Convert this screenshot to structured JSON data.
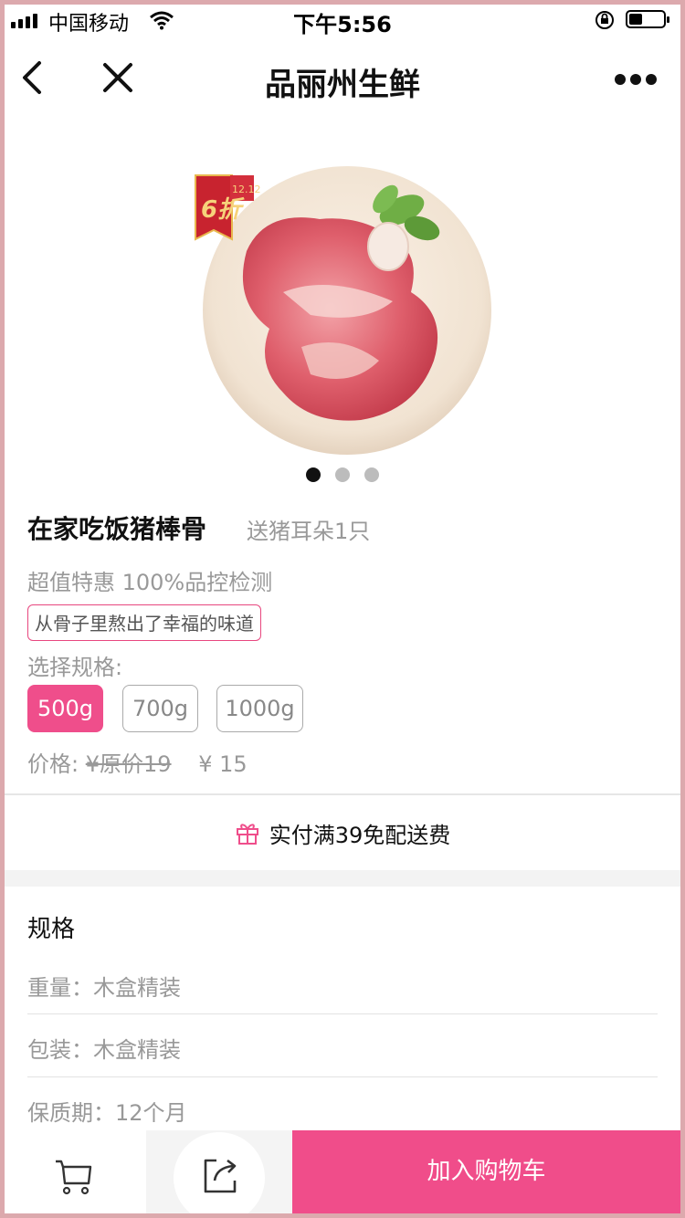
{
  "status_bar": {
    "carrier": "中国移动",
    "time": "下午5:56"
  },
  "nav": {
    "title": "品丽州生鲜"
  },
  "product": {
    "image_icon": "pork-bone-on-plate",
    "badge_text": "6折",
    "badge_tag": "12.12",
    "title": "在家吃饭猪棒骨",
    "gift": "送猪耳朵1只",
    "promo": "超值特惠 100%品控检测",
    "slogan": "从骨子里熬出了幸福的味道",
    "spec_label": "选择规格:",
    "specs": [
      "500g",
      "700g",
      "1000g"
    ],
    "selected_spec": "500g",
    "price_label": "价格:",
    "original_price": "¥原价19",
    "current_price": "¥ 15"
  },
  "shipping": {
    "icon": "gift-icon",
    "text": "实付满39免配送费"
  },
  "spec_section": {
    "title": "规格",
    "lines": [
      "重量：木盒精装",
      "包装：木盒精装",
      "保质期：12个月"
    ]
  },
  "bottom_bar": {
    "cart_icon": "cart-icon",
    "share_icon": "share-icon",
    "add_to_cart": "加入购物车"
  },
  "colors": {
    "accent": "#f04d8a",
    "frame": "#dca9ad"
  }
}
